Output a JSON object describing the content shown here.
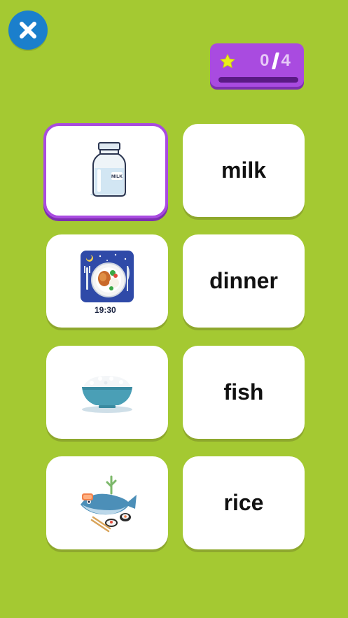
{
  "header": {
    "close_icon": "close-icon",
    "score": {
      "current": "0",
      "total": "4",
      "progress": 0,
      "icon": "star-icon"
    }
  },
  "cards": {
    "left": [
      {
        "type": "image",
        "icon": "milk-bottle-icon",
        "label": "MILK",
        "selected": true
      },
      {
        "type": "image",
        "icon": "dinner-plate-icon",
        "time": "19:30",
        "selected": false
      },
      {
        "type": "image",
        "icon": "rice-bowl-icon",
        "selected": false
      },
      {
        "type": "image",
        "icon": "fish-sushi-icon",
        "selected": false
      }
    ],
    "right": [
      {
        "type": "word",
        "text": "milk"
      },
      {
        "type": "word",
        "text": "dinner"
      },
      {
        "type": "word",
        "text": "fish"
      },
      {
        "type": "word",
        "text": "rice"
      }
    ]
  },
  "colors": {
    "background": "#a4c932",
    "close_button": "#1b7fcc",
    "score_panel": "#a94be0",
    "selected_border": "#a94be0",
    "card": "#ffffff"
  }
}
